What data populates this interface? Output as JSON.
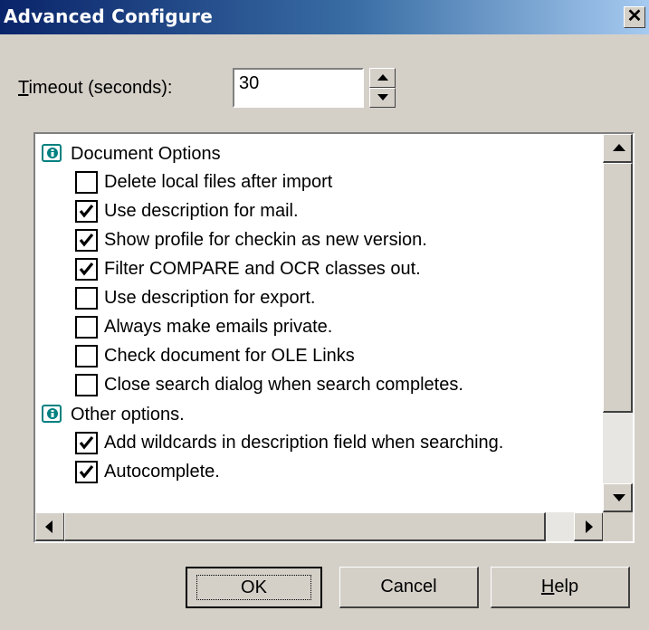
{
  "window": {
    "title": "Advanced Configure",
    "close_glyph": "✕"
  },
  "timeout": {
    "label_mnemonic": "T",
    "label_rest": "imeout (seconds):",
    "value": "30"
  },
  "tree": {
    "groups": [
      {
        "label": "Document Options",
        "icon": "options-group-icon",
        "items": [
          {
            "label": "Delete local files after import",
            "checked": false
          },
          {
            "label": "Use description for mail.",
            "checked": true
          },
          {
            "label": "Show profile for checkin as new version.",
            "checked": true
          },
          {
            "label": "Filter COMPARE and OCR classes out.",
            "checked": true
          },
          {
            "label": "Use description for export.",
            "checked": false
          },
          {
            "label": "Always make emails private.",
            "checked": false
          },
          {
            "label": "Check document for OLE Links",
            "checked": false
          },
          {
            "label": "Close search dialog when search completes.",
            "checked": false
          }
        ]
      },
      {
        "label": "Other options.",
        "icon": "options-group-icon",
        "items": [
          {
            "label": "Add wildcards in description field when searching.",
            "checked": true
          },
          {
            "label": "Autocomplete.",
            "checked": true
          }
        ]
      }
    ]
  },
  "buttons": {
    "ok": "OK",
    "cancel": "Cancel",
    "help_mnemonic": "H",
    "help_rest": "elp"
  },
  "colors": {
    "dialog_bg": "#d4d0c8",
    "title_start": "#0a246a",
    "title_end": "#a6caf0",
    "icon_teal": "#008080"
  }
}
